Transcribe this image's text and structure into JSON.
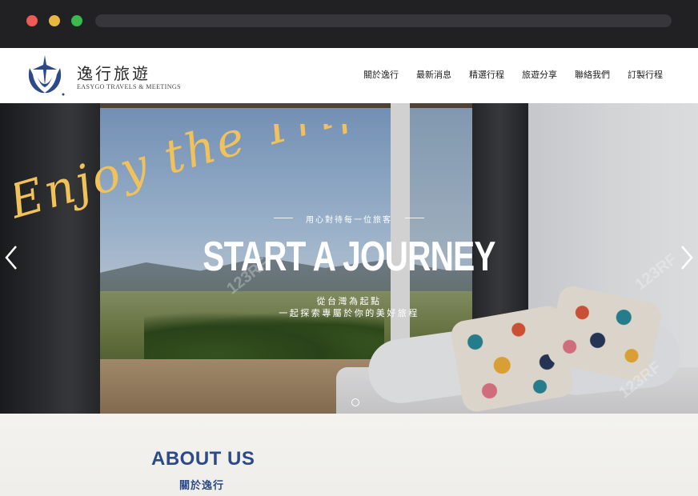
{
  "browser": {
    "window_controls": [
      "close",
      "minimize",
      "maximize"
    ],
    "colors": {
      "close": "#ee5a55",
      "minimize": "#e8b73f",
      "maximize": "#3ab94d"
    }
  },
  "header": {
    "brand_name": "逸行旅遊",
    "brand_sub": "EASYGO TRAVELS & MEETINGS",
    "logo_icon": "globe-airplane-logo",
    "nav": [
      {
        "label": "關於逸行"
      },
      {
        "label": "最新消息"
      },
      {
        "label": "精選行程"
      },
      {
        "label": "旅遊分享"
      },
      {
        "label": "聯絡我們"
      },
      {
        "label": "訂製行程"
      }
    ]
  },
  "hero": {
    "script_title": "Enjoy the Trip",
    "tagline": "用心對待每一位旅客",
    "headline": "START A JOURNEY",
    "subline_1": "從台灣為起點",
    "subline_2": "一起探索專屬於你的美好旅程",
    "watermarks": [
      "123RF",
      "123RF",
      "123RF"
    ],
    "prev_icon": "chevron-left-icon",
    "next_icon": "chevron-right-icon",
    "slide_count": 1,
    "active_slide": 1
  },
  "about": {
    "title": "ABOUT US",
    "subtitle": "關於逸行"
  },
  "colors": {
    "brand_blue": "#2c4a87",
    "script_gold": "#f2c25a"
  }
}
